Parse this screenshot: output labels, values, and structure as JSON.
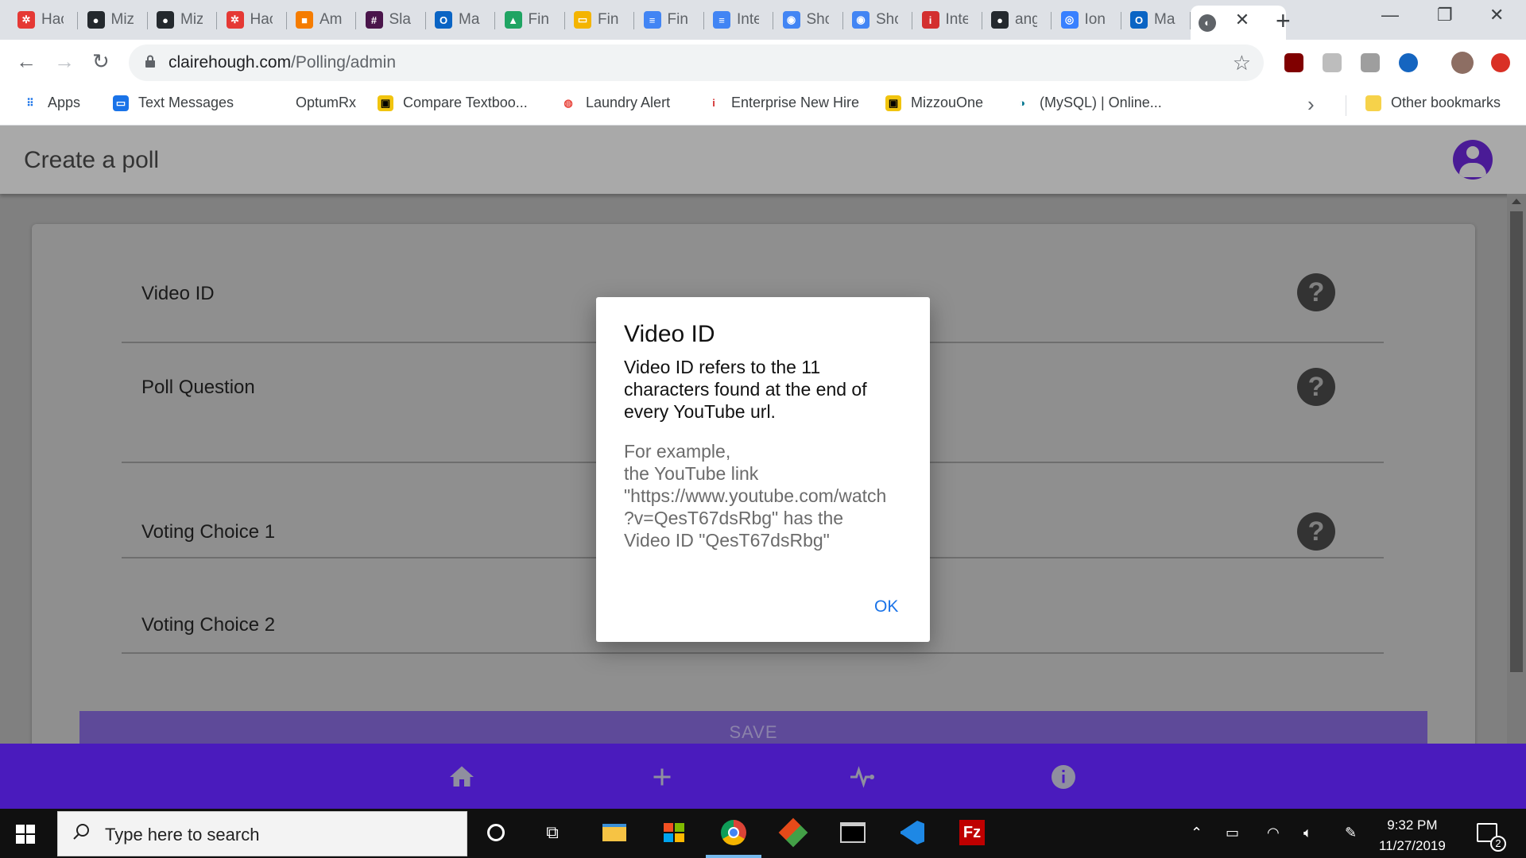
{
  "browser": {
    "tabs": [
      {
        "label": "Hac",
        "icon": "hackathon-icon",
        "color": "#e53935"
      },
      {
        "label": "Miz",
        "icon": "github-icon",
        "color": "#24292e"
      },
      {
        "label": "Miz",
        "icon": "github-icon",
        "color": "#24292e"
      },
      {
        "label": "Hac",
        "icon": "hackathon-icon",
        "color": "#e53935"
      },
      {
        "label": "Am",
        "icon": "aws-icon",
        "color": "#f57c00"
      },
      {
        "label": "Sla",
        "icon": "slack-icon",
        "color": "#4a154b"
      },
      {
        "label": "Ma",
        "icon": "outlook-icon",
        "color": "#0a64c4"
      },
      {
        "label": "Fin",
        "icon": "drive-icon",
        "color": "#1fa463"
      },
      {
        "label": "Fin",
        "icon": "slides-icon",
        "color": "#f4b400"
      },
      {
        "label": "Fin",
        "icon": "docs-icon",
        "color": "#4285f4"
      },
      {
        "label": "Inte",
        "icon": "docs-icon",
        "color": "#4285f4"
      },
      {
        "label": "Sho",
        "icon": "chat-icon",
        "color": "#4285f4"
      },
      {
        "label": "Sho",
        "icon": "chat-icon",
        "color": "#4285f4"
      },
      {
        "label": "Inte",
        "icon": "info-i-icon",
        "color": "#d32f2f"
      },
      {
        "label": "ang",
        "icon": "github-icon",
        "color": "#24292e"
      },
      {
        "label": "Ion",
        "icon": "ionic-icon",
        "color": "#3880ff"
      },
      {
        "label": "Ma",
        "icon": "outlook-icon",
        "color": "#0a64c4"
      }
    ],
    "url_domain": "clairehough.com",
    "url_path": "/Polling/admin",
    "bookmarks": [
      {
        "label": "Apps",
        "icon": "apps-grid-icon"
      },
      {
        "label": "Text Messages",
        "icon": "messages-icon"
      },
      {
        "label": "OptumRx",
        "icon": "optum-icon"
      },
      {
        "label": "Compare Textboo...",
        "icon": "textbook-icon"
      },
      {
        "label": "Laundry Alert",
        "icon": "laundry-icon"
      },
      {
        "label": "Enterprise New Hire",
        "icon": "enterprise-icon"
      },
      {
        "label": "MizzouOne",
        "icon": "mizzou-icon"
      },
      {
        "label": "(MySQL) | Online...",
        "icon": "mysql-icon"
      }
    ],
    "other_bookmarks": "Other bookmarks"
  },
  "app": {
    "title": "Create a poll",
    "fields": [
      {
        "label": "Video ID"
      },
      {
        "label": "Poll Question"
      },
      {
        "label": "Voting Choice 1"
      },
      {
        "label": "Voting Choice 2"
      }
    ],
    "help_glyph": "?",
    "save_label": "SAVE",
    "accent_color": "#4a1bbd"
  },
  "dialog": {
    "title": "Video ID",
    "body": "Video ID refers to the 11 characters found at the end of every YouTube url.",
    "example_lines": [
      "For example,",
      "the YouTube link",
      "\"https://www.youtube.com/watch",
      "?v=QesT67dsRbg\" has the",
      "Video ID \"QesT67dsRbg\""
    ],
    "ok_label": "OK"
  },
  "taskbar": {
    "search_placeholder": "Type here to search",
    "time": "9:32 PM",
    "date": "11/27/2019",
    "notification_count": "2"
  }
}
